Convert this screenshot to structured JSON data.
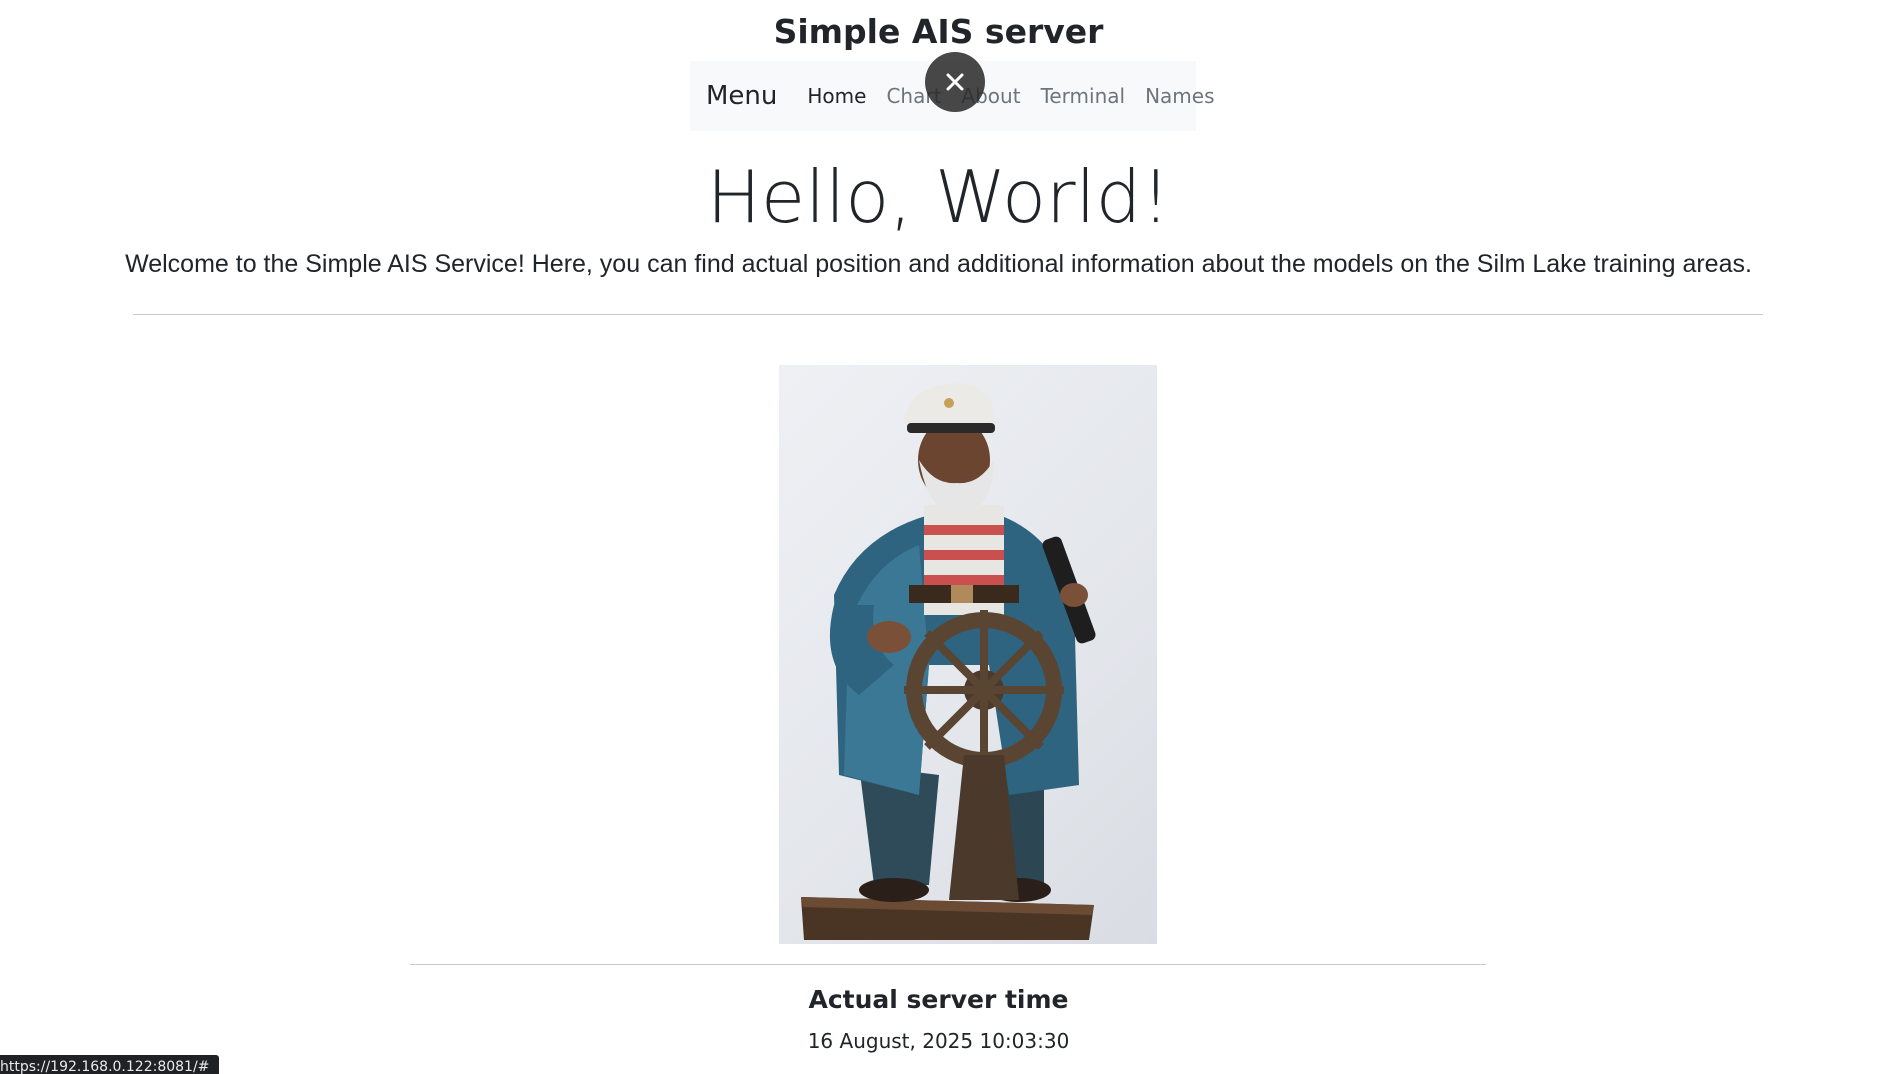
{
  "header": {
    "site_title": "Simple AIS server"
  },
  "navbar": {
    "brand": "Menu",
    "links": [
      {
        "label": "Home",
        "active": true
      },
      {
        "label": "Chart",
        "active": false
      },
      {
        "label": "About",
        "active": false
      },
      {
        "label": "Terminal",
        "active": false
      },
      {
        "label": "Names",
        "active": false
      }
    ]
  },
  "overlay": {
    "close_icon": "close-icon"
  },
  "hero": {
    "title": "Hello, World!",
    "lead": "Welcome to the Simple AIS Service! Here, you can find actual position and additional information about the models on the Silm Lake training areas."
  },
  "server_time": {
    "heading": "Actual server time",
    "value": "16 August, 2025 10:03:30"
  },
  "status_bar": {
    "url": "https://192.168.0.122:8081/#"
  },
  "colors": {
    "navbar_bg": "#f8f9fa",
    "text": "#212529",
    "muted_link": "#6c757d",
    "overlay_button": "#282828"
  }
}
